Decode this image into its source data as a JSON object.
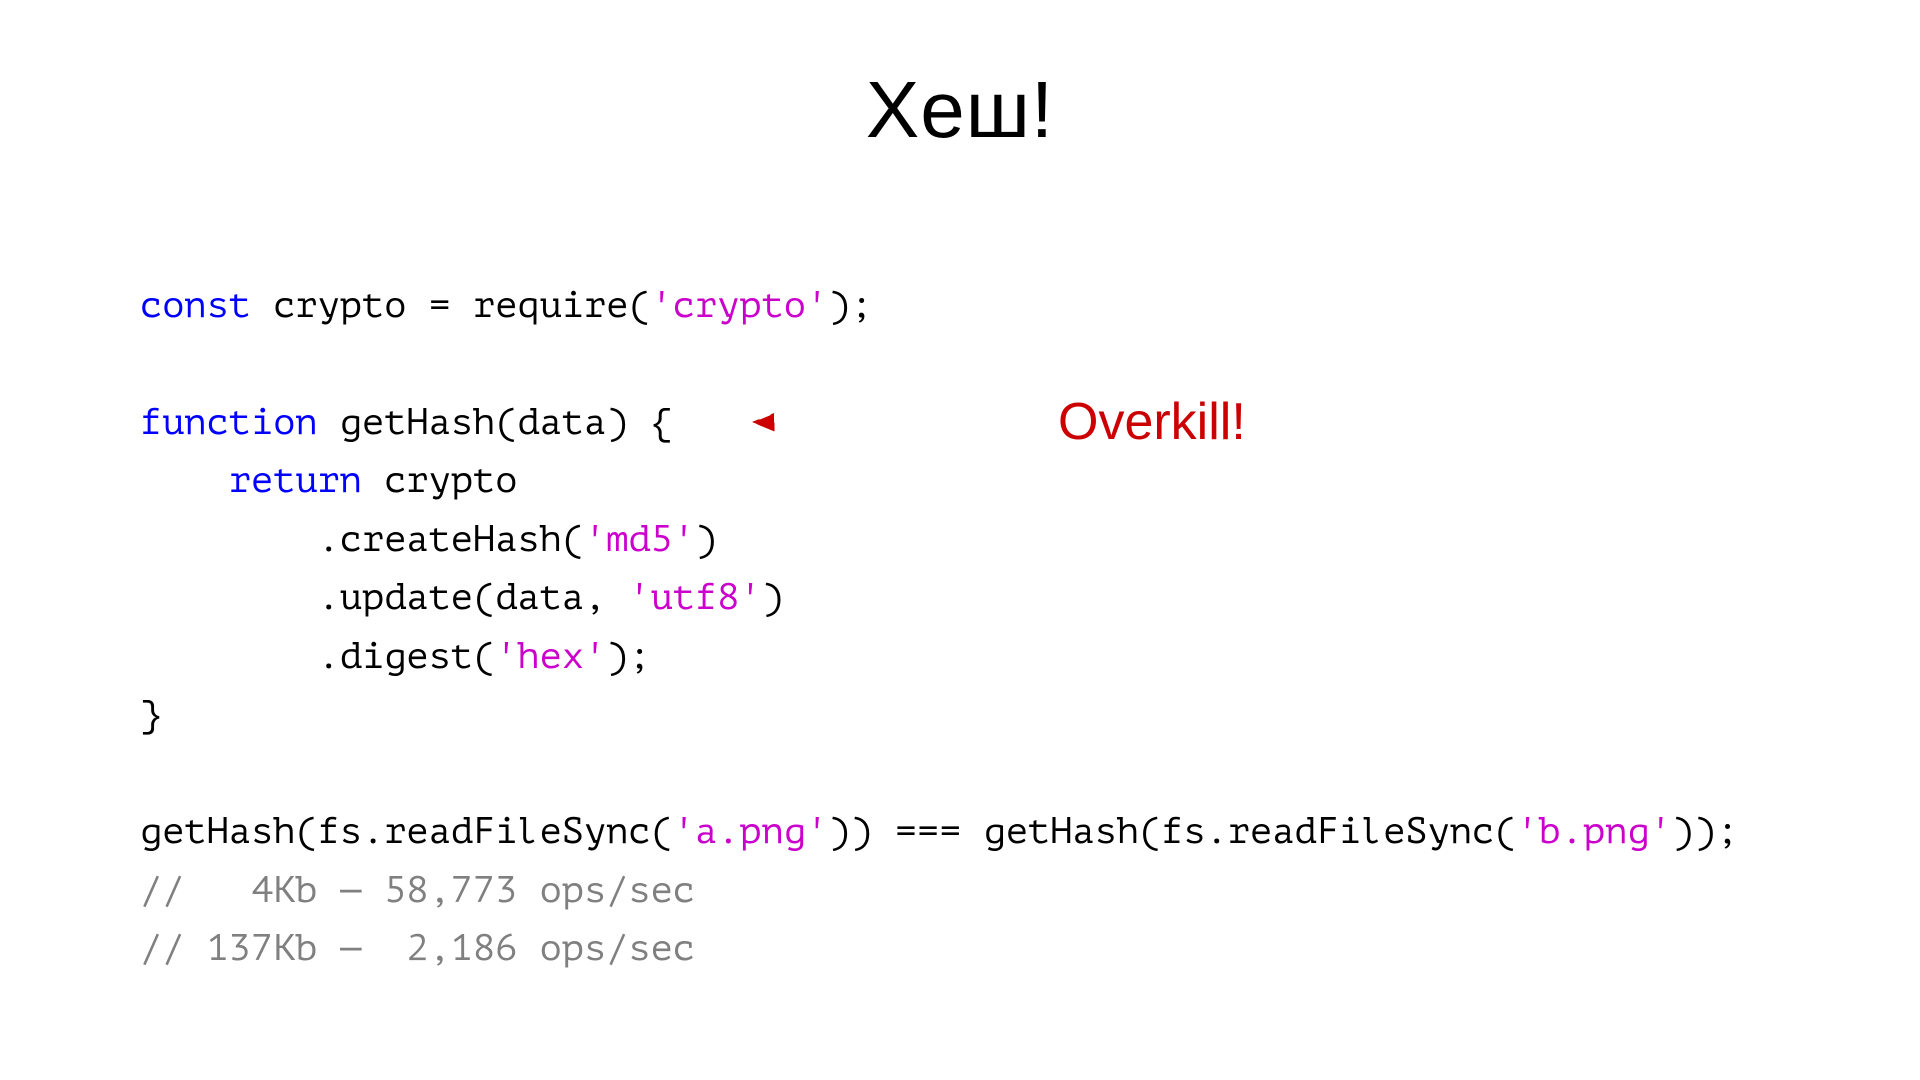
{
  "title": "Хеш!",
  "annotation": {
    "label": "Overkill!",
    "color": "#CC0000"
  },
  "code": {
    "line1": {
      "kw": "const",
      "rest": " crypto = require(",
      "str": "'crypto'",
      "end": ");"
    },
    "line2": {
      "kw": "function",
      "name": " getHash(data) {"
    },
    "line3": {
      "indent": "    ",
      "kw": "return",
      "rest": " crypto"
    },
    "line4": {
      "indent": "        ",
      "call": ".createHash(",
      "str": "'md5'",
      "end": ")"
    },
    "line5": {
      "indent": "        ",
      "call": ".update(data, ",
      "str": "'utf8'",
      "end": ")"
    },
    "line6": {
      "indent": "        ",
      "call": ".digest(",
      "str": "'hex'",
      "end": ");"
    },
    "line7": "}",
    "line8": {
      "p1": "getHash(fs.readFileSync(",
      "s1": "'a.png'",
      "p2": ")) === getHash(fs.readFileSync(",
      "s2": "'b.png'",
      "p3": "));"
    },
    "bench1": "//   4Kb — 58,773 ops/sec",
    "bench2": "// 137Kb —  2,186 ops/sec"
  }
}
